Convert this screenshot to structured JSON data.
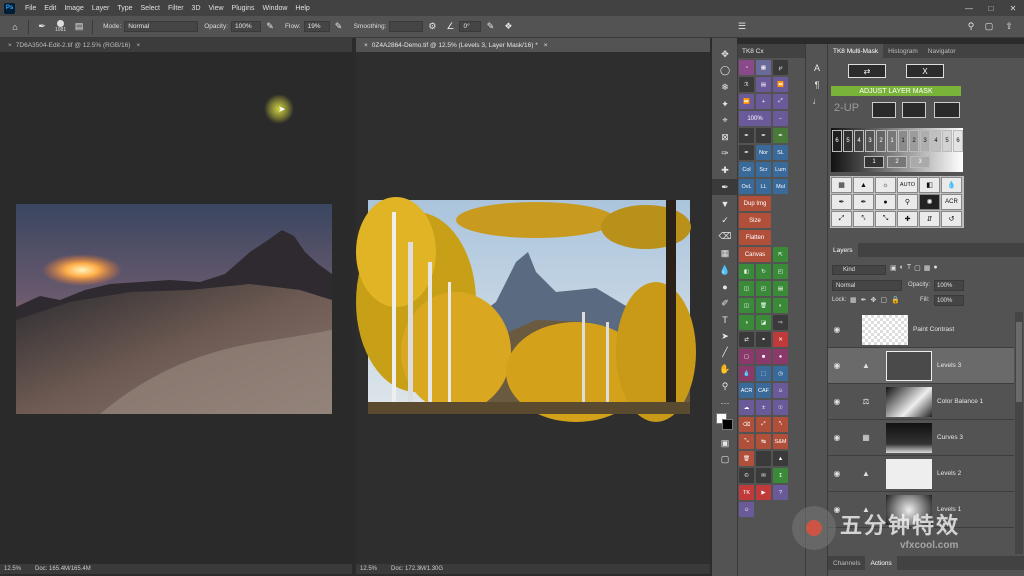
{
  "menu": [
    "File",
    "Edit",
    "Image",
    "Layer",
    "Type",
    "Select",
    "Filter",
    "3D",
    "View",
    "Plugins",
    "Window",
    "Help"
  ],
  "app_logo": "Ps",
  "options": {
    "brush_size": "1081",
    "mode_label": "Mode:",
    "mode_value": "Normal",
    "opacity_label": "Opacity:",
    "opacity_value": "100%",
    "flow_label": "Flow:",
    "flow_value": "19%",
    "smoothing_label": "Smoothing:",
    "angle_value": "0°"
  },
  "documents": [
    {
      "tab": "7D6A3504-Edit-2.tif @ 12.5% (RGB/16)",
      "zoom": "12.5%",
      "doc_info": "Doc: 165.4M/165.4M"
    },
    {
      "tab": "0Z4A2864-Demo.tif @ 12.5% (Levels 3, Layer Mask/16) *",
      "zoom": "12.5%",
      "doc_info": "Doc: 172.3M/1.30G"
    }
  ],
  "tk8cx": {
    "title": "TK8 Cx",
    "labels": [
      "Nor",
      "SL",
      "Col",
      "Scr",
      "Lum",
      "OvL",
      "LL",
      "Mul",
      "Dup Img",
      "Size",
      "Flatten",
      "Canvas",
      "ACR",
      "CAF",
      "S&M",
      "TK",
      "100%"
    ]
  },
  "multimask": {
    "tabs": [
      "TK8 Multi-Mask",
      "Histogram",
      "Navigator"
    ],
    "close_label": "X",
    "adjust_label": "ADJUST LAYER MASK",
    "twoup_label": "2-UP",
    "zone_row1": [
      "6",
      "5",
      "4",
      "3",
      "2",
      "1",
      "1",
      "2",
      "3",
      "4",
      "5",
      "6"
    ],
    "zone_row2": [
      "1",
      "2",
      "3"
    ],
    "acr_label": "ACR",
    "auto_label": "AUTO"
  },
  "layers": {
    "tab": "Layers",
    "kind_label": "Kind",
    "blend_mode": "Normal",
    "opacity_label": "Opacity:",
    "opacity_value": "100%",
    "lock_label": "Lock:",
    "fill_label": "Fill:",
    "fill_value": "100%",
    "items": [
      {
        "name": "Paint Contrast"
      },
      {
        "name": "Levels 3"
      },
      {
        "name": "Color Balance 1"
      },
      {
        "name": "Curves 3"
      },
      {
        "name": "Levels 2"
      },
      {
        "name": "Levels 1"
      }
    ],
    "bottom_tabs": [
      "Channels",
      "Actions"
    ]
  },
  "watermark": {
    "cn": "五分钟特效",
    "url": "vfxcool.com"
  }
}
